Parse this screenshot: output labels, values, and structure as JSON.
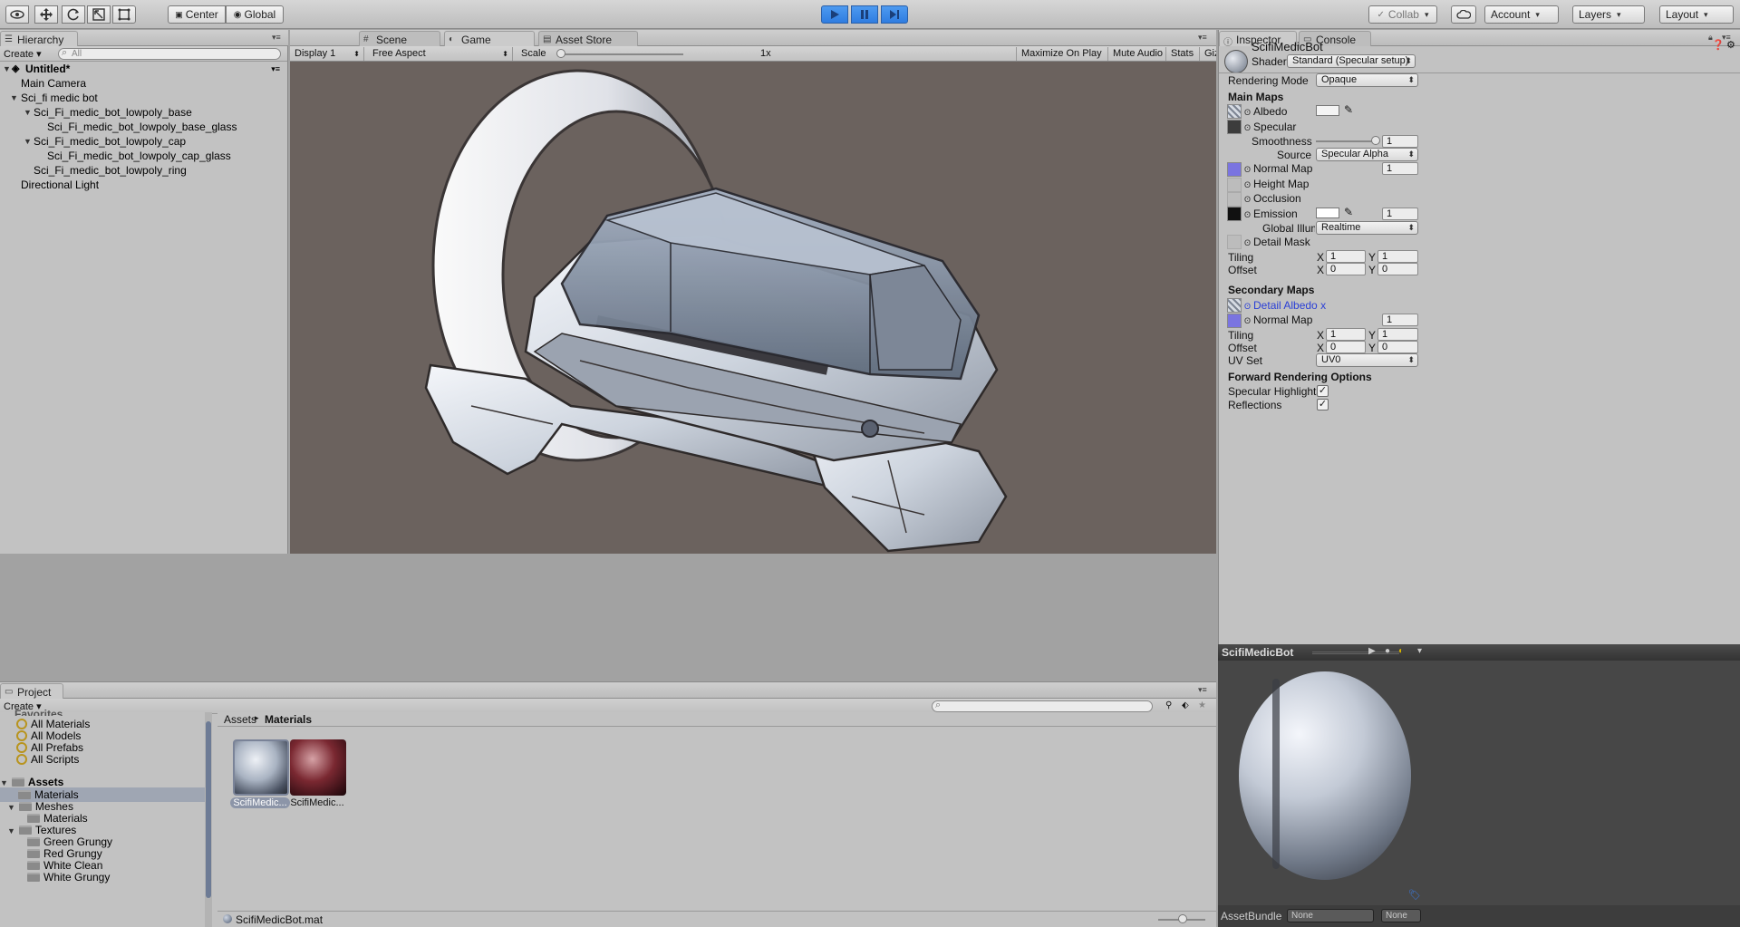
{
  "toolbar": {
    "pivot_center": "Center",
    "pivot_global": "Global",
    "collab": "Collab",
    "account": "Account",
    "layers": "Layers",
    "layout": "Layout",
    "play_color": "#2f7de1"
  },
  "hierarchy": {
    "tab": "Hierarchy",
    "create": "Create",
    "search_placeholder": "All",
    "scene": "Untitled*",
    "items": [
      "Main Camera",
      "Sci_fi medic bot",
      "Sci_Fi_medic_bot_lowpoly_base",
      "Sci_Fi_medic_bot_lowpoly_base_glass",
      "Sci_Fi_medic_bot_lowpoly_cap",
      "Sci_Fi_medic_bot_lowpoly_cap_glass",
      "Sci_Fi_medic_bot_lowpoly_ring",
      "Directional Light"
    ]
  },
  "center": {
    "tabs": [
      "Scene",
      "Game",
      "Asset Store"
    ],
    "display": "Display 1",
    "aspect": "Free Aspect",
    "scale_label": "Scale",
    "scale_value": "1x",
    "maximize": "Maximize On Play",
    "mute": "Mute Audio",
    "stats": "Stats",
    "gizmos": "Gizmos",
    "background_color": "#6b625e"
  },
  "inspector": {
    "tabs": [
      "Inspector",
      "Console"
    ],
    "material_name": "ScifiMedicBot",
    "shader_label": "Shader",
    "shader_value": "Standard (Specular setup)",
    "rendering_mode_label": "Rendering Mode",
    "rendering_mode_value": "Opaque",
    "main_maps": "Main Maps",
    "albedo": "Albedo",
    "specular": "Specular",
    "smoothness": "Smoothness",
    "smoothness_value": "1",
    "source": "Source",
    "source_value": "Specular Alpha",
    "normal_map": "Normal Map",
    "normal_value": "1",
    "height_map": "Height Map",
    "occlusion": "Occlusion",
    "emission": "Emission",
    "emission_value": "1",
    "global_illum": "Global Illumi",
    "global_illum_value": "Realtime",
    "detail_mask": "Detail Mask",
    "tiling": "Tiling",
    "offset": "Offset",
    "x": "X",
    "y": "Y",
    "tiling_x": "1",
    "tiling_y": "1",
    "offset_x": "0",
    "offset_y": "0",
    "secondary_maps": "Secondary Maps",
    "detail_albedo": "Detail Albedo x",
    "sec_normal_map": "Normal Map",
    "sec_normal_value": "1",
    "sec_tiling_x": "1",
    "sec_tiling_y": "1",
    "sec_offset_x": "0",
    "sec_offset_y": "0",
    "uv_set": "UV Set",
    "uv_set_value": "UV0",
    "forward_options": "Forward Rendering Options",
    "specular_highlights": "Specular Highlights",
    "reflections": "Reflections",
    "check": "✓",
    "normal_color": "#7a74e0"
  },
  "preview": {
    "title": "ScifiMedicBot",
    "assetbundle_label": "AssetBundle",
    "assetbundle_value": "None",
    "variant_value": "None"
  },
  "project": {
    "tab": "Project",
    "create": "Create",
    "favorites": "Favorites",
    "fav_items": [
      "All Materials",
      "All Models",
      "All Prefabs",
      "All Scripts"
    ],
    "assets_root": "Assets",
    "tree": [
      "Materials",
      "Meshes",
      "Materials",
      "Textures",
      "Green Grungy",
      "Red Grungy",
      "White Clean",
      "White Grungy"
    ],
    "breadcrumb_root": "Assets",
    "breadcrumb_current": "Materials",
    "breadcrumb_sep": "▸",
    "assets": [
      "ScifiMedic...",
      "ScifiMedic..."
    ],
    "selected_file": "ScifiMedicBot.mat"
  }
}
